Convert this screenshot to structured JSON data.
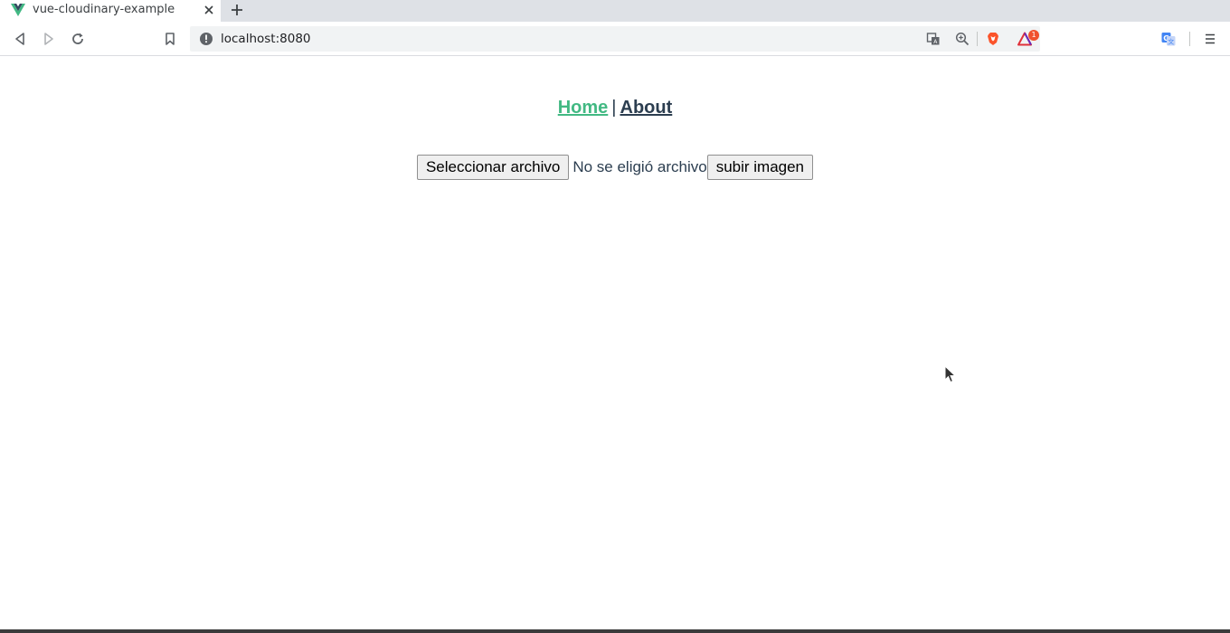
{
  "browser": {
    "tab": {
      "title": "vue-cloudinary-example",
      "favicon": "vue-logo-icon"
    },
    "address": {
      "url": "localhost:8080"
    },
    "extension_badge_count": "1",
    "colors": {
      "tab_strip": "#dee1e6",
      "omnibox": "#f1f3f4"
    }
  },
  "page": {
    "nav": {
      "home_label": "Home",
      "separator": "|",
      "about_label": "About",
      "active_color": "#42b983",
      "text_color": "#2c3e50"
    },
    "upload": {
      "choose_file_label": "Seleccionar archivo",
      "file_status": "No se eligió archivo",
      "upload_button_label": "subir imagen"
    }
  }
}
